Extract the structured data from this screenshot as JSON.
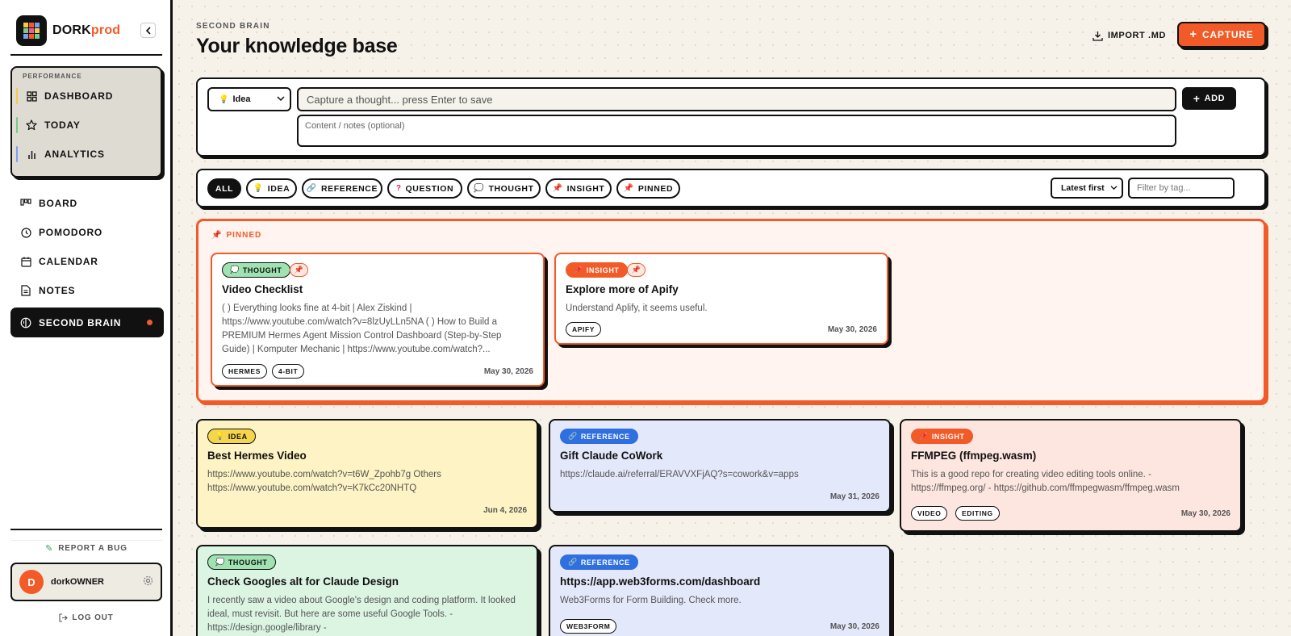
{
  "brand": {
    "name_dark": "DORK",
    "name_accent": "prod"
  },
  "sidebar": {
    "performance_label": "PERFORMANCE",
    "performance_items": [
      {
        "label": "DASHBOARD",
        "icon": "grid-icon",
        "color": "#f5c94b"
      },
      {
        "label": "TODAY",
        "icon": "star-icon",
        "color": "#7ac98c"
      },
      {
        "label": "ANALYTICS",
        "icon": "bar-chart-icon",
        "color": "#7f9cf5"
      }
    ],
    "nav_items": [
      {
        "label": "BOARD",
        "icon": "kanban-icon"
      },
      {
        "label": "POMODORO",
        "icon": "clock-icon"
      },
      {
        "label": "CALENDAR",
        "icon": "calendar-icon"
      },
      {
        "label": "NOTES",
        "icon": "document-icon"
      },
      {
        "label": "SECOND BRAIN",
        "icon": "brain-icon",
        "active": true
      }
    ],
    "report_bug": "REPORT A BUG",
    "user": {
      "initial": "D",
      "name": "dorkOWNER"
    },
    "logout": "LOG OUT"
  },
  "header": {
    "eyebrow": "SECOND BRAIN",
    "title": "Your knowledge base",
    "import_label": "IMPORT .MD",
    "capture_label": "CAPTURE"
  },
  "capture_form": {
    "type_value": "Idea",
    "title_placeholder": "Capture a thought... press Enter to save",
    "notes_placeholder": "Content / notes (optional)",
    "add_label": "ADD"
  },
  "filters": {
    "chips": [
      "ALL",
      "IDEA",
      "REFERENCE",
      "QUESTION",
      "THOUGHT",
      "INSIGHT",
      "PINNED"
    ],
    "sort_value": "Latest first",
    "tag_placeholder": "Filter by tag..."
  },
  "pinned": {
    "label": "PINNED",
    "cards": [
      {
        "type": "THOUGHT",
        "title": "Video Checklist",
        "body": "( ) Everything looks fine at 4-bit | Alex Ziskind | https://www.youtube.com/watch?v=8lzUyLLn5NA ( ) How to Build a PREMIUM Hermes Agent Mission Control Dashboard (Step-by-Step Guide) | Komputer Mechanic | https://www.youtube.com/watch?...",
        "tags": [
          "HERMES",
          "4-BIT"
        ],
        "date": "May 30, 2026"
      },
      {
        "type": "INSIGHT",
        "title": "Explore more of Apify",
        "body": "Understand Aplify, it seems useful.",
        "tags": [
          "APIFY"
        ],
        "date": "May 30, 2026"
      }
    ]
  },
  "cards": [
    {
      "type": "IDEA",
      "title": "Best Hermes Video",
      "body": "https://www.youtube.com/watch?v=t6W_Zpohb7g Others https://www.youtube.com/watch?v=K7kCc20NHTQ",
      "tags": [],
      "date": "Jun 4, 2026"
    },
    {
      "type": "REFERENCE",
      "title": "Gift Claude CoWork",
      "body": "https://claude.ai/referral/ERAVVXFjAQ?s=cowork&v=apps",
      "tags": [],
      "date": "May 31, 2026"
    },
    {
      "type": "INSIGHT",
      "title": "FFMPEG (ffmpeg.wasm)",
      "body": "This is a good repo for creating video editing tools online. - https://ffmpeg.org/ - https://github.com/ffmpegwasm/ffmpeg.wasm",
      "tags": [
        "VIDEO",
        "EDITING"
      ],
      "date": "May 30, 2026"
    },
    {
      "type": "THOUGHT",
      "title": "Check Googles alt for Claude Design",
      "body": "I recently saw a video about Google's design and coding platform. It looked ideal, must revisit. But here are some useful Google Tools. - https://design.google/library -",
      "tags": [],
      "date": ""
    },
    {
      "type": "REFERENCE",
      "title": "https://app.web3forms.com/dashboard",
      "body": "Web3Forms for Form Building. Check more.",
      "tags": [
        "WEB3FORM"
      ],
      "date": "May 30, 2026"
    }
  ],
  "colors": {
    "accent": "#f25a27",
    "idea_bg": "#fdf3c4",
    "reference_bg": "#e4e8fb",
    "insight_bg": "#fde6df",
    "thought_bg": "#dcf5e3"
  }
}
